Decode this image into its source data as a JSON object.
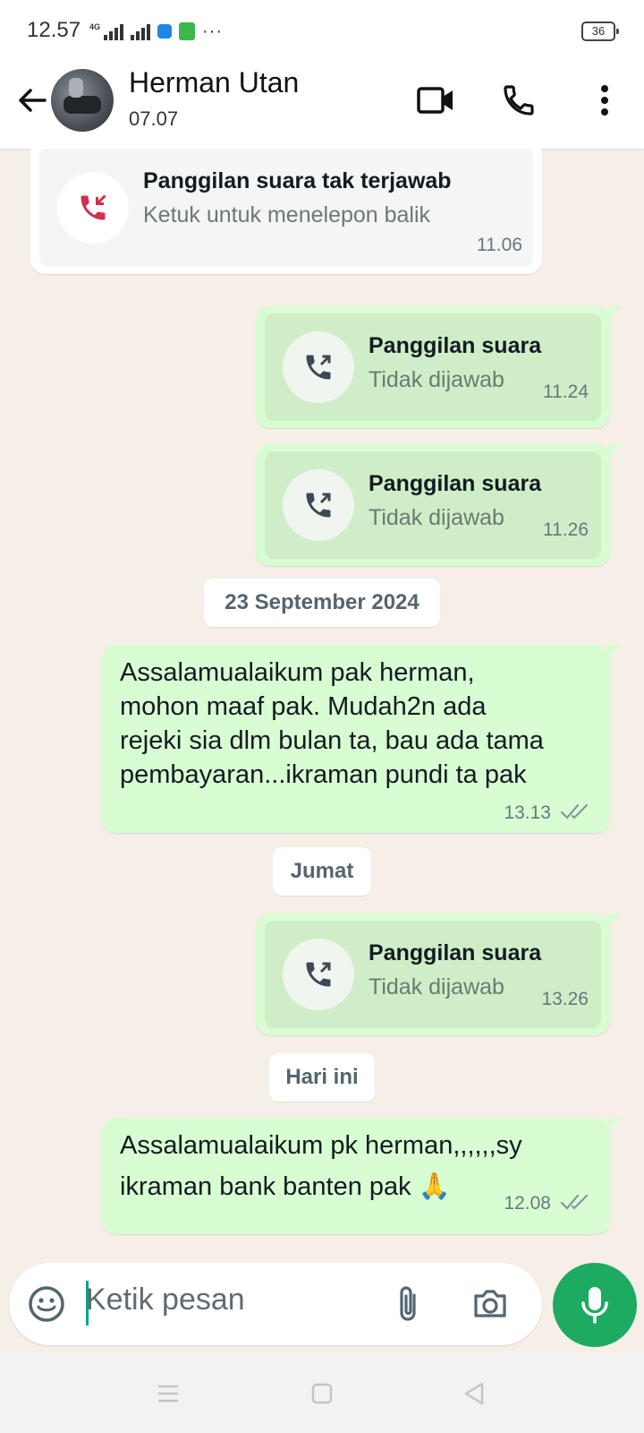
{
  "status_bar": {
    "time": "12.57",
    "network": "4G",
    "battery": "36"
  },
  "header": {
    "name": "Herman Utan",
    "subtitle": "07.07"
  },
  "messages": {
    "missed_call": {
      "title": "Panggilan suara tak terjawab",
      "subtitle": "Ketuk untuk menelepon balik",
      "time": "11.06"
    },
    "call1": {
      "title": "Panggilan suara",
      "subtitle": "Tidak dijawab",
      "time": "11.24"
    },
    "call2": {
      "title": "Panggilan suara",
      "subtitle": "Tidak dijawab",
      "time": "11.26"
    },
    "date1": "23 September 2024",
    "text1": {
      "lines": [
        "Assalamualaikum pak herman,",
        "mohon maaf pak. Mudah2n ada",
        "rejeki sia dlm bulan ta, bau ada tama",
        "pembayaran...ikraman pundi ta pak"
      ],
      "time": "13.13"
    },
    "date2": "Jumat",
    "call3": {
      "title": "Panggilan suara",
      "subtitle": "Tidak dijawab",
      "time": "13.26"
    },
    "date3": "Hari ini",
    "text2": {
      "lines": [
        "Assalamualaikum pk herman,,,,,,sy",
        "ikraman bank banten pak 🙏"
      ],
      "time": "12.08"
    }
  },
  "composer": {
    "placeholder": "Ketik pesan"
  },
  "colors": {
    "outgoing": "#d9fdd3",
    "accent": "#1daa61",
    "missed": "#d32f4e",
    "background": "#f5efe7"
  },
  "icons": [
    "back-arrow-icon",
    "video-call-icon",
    "voice-call-icon",
    "more-options-icon",
    "missed-call-icon",
    "outgoing-call-icon",
    "emoji-icon",
    "attach-icon",
    "camera-icon",
    "mic-icon",
    "read-ticks-icon"
  ]
}
